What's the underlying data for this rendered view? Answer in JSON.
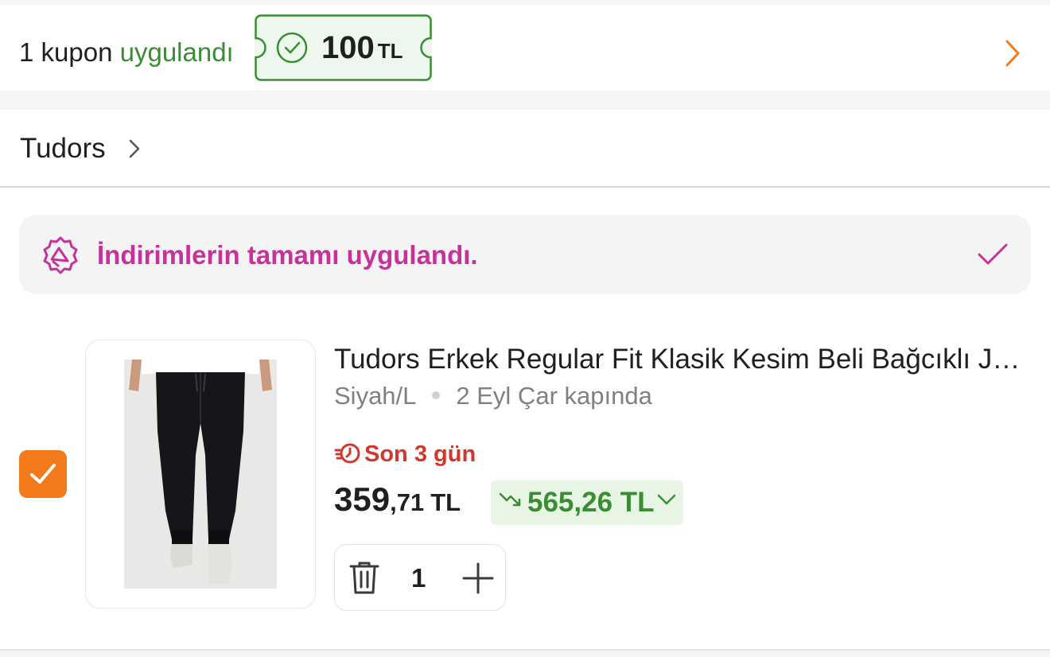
{
  "coupon": {
    "count_text": "1 kupon",
    "status_text": "uygulandı",
    "amount": "100",
    "currency": "TL",
    "icon": "check-circle-icon",
    "arrow_icon": "chevron-right-icon"
  },
  "seller": {
    "name": "Tudors",
    "arrow_icon": "chevron-right-icon"
  },
  "discount_banner": {
    "text": "İndirimlerin tamamı uygulandı.",
    "icon": "discount-badge-icon",
    "check_icon": "check-icon"
  },
  "product": {
    "selected": true,
    "title": "Tudors Erkek Regular Fit Klasik Kesim Beli Bağcıklı Jogger Eşofman Altı",
    "variant": "Siyah/L",
    "delivery": "2 Eyl Çar kapında",
    "campaign": {
      "text": "Son 3 gün",
      "icon": "fast-timer-icon"
    },
    "price": {
      "main": "359",
      "decimal": ",71",
      "currency": "TL"
    },
    "old_price": {
      "text": "565,26 TL",
      "icon": "trend-down-icon"
    },
    "quantity": "1",
    "delete_icon": "trash-icon",
    "increase_icon": "plus-icon"
  },
  "colors": {
    "accent_orange": "#f27a1a",
    "success_green": "#3a8d35",
    "discount_pink": "#c8319c",
    "campaign_red": "#d1372c"
  }
}
